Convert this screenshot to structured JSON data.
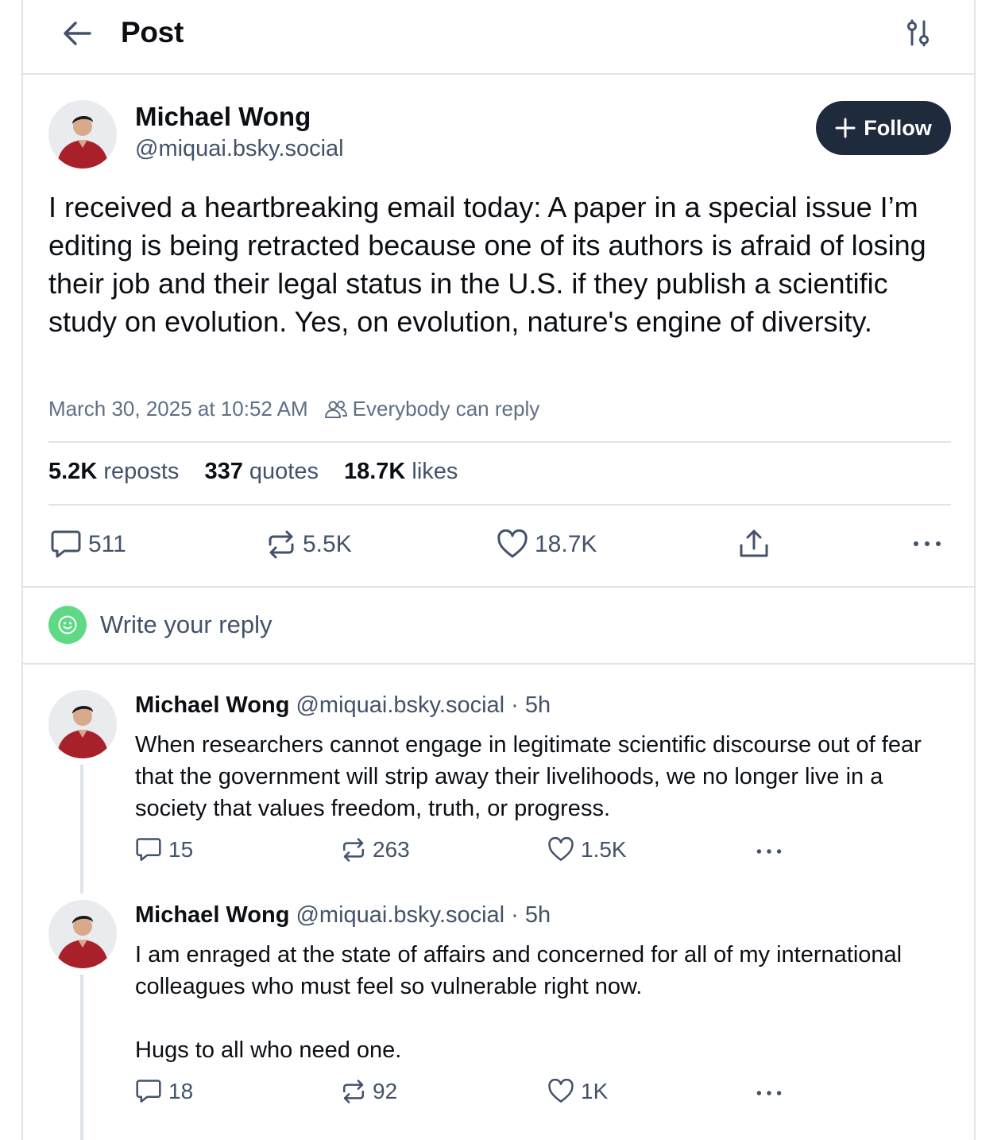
{
  "header": {
    "title": "Post"
  },
  "post": {
    "author_name": "Michael Wong",
    "author_handle": "@miquai.bsky.social",
    "follow_label": "Follow",
    "text": "I received a heartbreaking email today: A paper in a special issue I’m editing is being retracted because one of its authors is afraid of losing their job and their legal status in the U.S. if they publish a scientific study on evolution. Yes, on evolution, nature's engine of diversity.",
    "timestamp": "March 30, 2025 at 10:52 AM",
    "reply_setting": "Everybody can reply",
    "stats": {
      "reposts_count": "5.2K",
      "reposts_label": "reposts",
      "quotes_count": "337",
      "quotes_label": "quotes",
      "likes_count": "18.7K",
      "likes_label": "likes"
    },
    "actions": {
      "replies": "511",
      "reposts": "5.5K",
      "likes": "18.7K"
    }
  },
  "composer": {
    "placeholder": "Write your reply"
  },
  "replies": [
    {
      "author_name": "Michael Wong",
      "author_handle": "@miquai.bsky.social",
      "time": "· 5h",
      "text": "When researchers cannot engage in legitimate scientific discourse out of fear that the government will strip away their livelihoods, we no longer live in a society that values freedom, truth, or progress.",
      "reply_count": "15",
      "repost_count": "263",
      "like_count": "1.5K"
    },
    {
      "author_name": "Michael Wong",
      "author_handle": "@miquai.bsky.social",
      "time": "· 5h",
      "text_line1": "I am enraged at the state of affairs and concerned for all of my international colleagues who must feel so vulnerable right now.",
      "text_line2": "Hugs to all who need one.",
      "reply_count": "18",
      "repost_count": "92",
      "like_count": "1K"
    }
  ],
  "icons": {
    "back": "arrow-left-icon",
    "settings": "sliders-icon",
    "plus": "plus-icon",
    "people": "people-icon",
    "reply": "speech-bubble-icon",
    "repost": "repost-icon",
    "like": "heart-icon",
    "share": "share-icon",
    "more": "ellipsis-icon",
    "smiley": "smiley-icon"
  },
  "colors": {
    "follow_bg": "#1f2b3c",
    "composer_avatar": "#5fd986",
    "secondary_text": "#43526a",
    "divider": "#dfe4ea"
  }
}
